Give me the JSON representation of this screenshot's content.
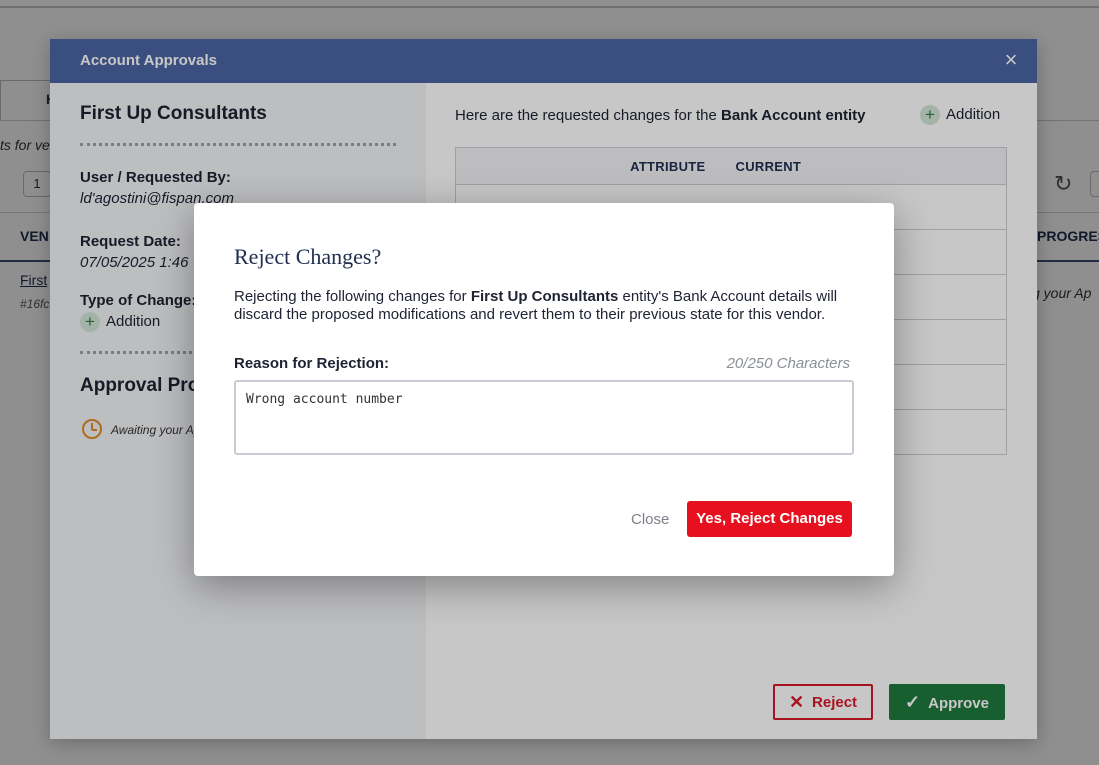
{
  "background": {
    "tab_label": "H",
    "subtitle": "ts for ve",
    "pager_value": "1",
    "col_vendor": "VEN",
    "col_progress": "PROGRES",
    "row_vendor": "First",
    "row_id": "#16fc",
    "row_status": "g your Ap"
  },
  "approvals": {
    "title": "Account Approvals",
    "close_icon": "×",
    "left": {
      "vendor_name": "First Up Consultants",
      "user_label": "User / Requested By:",
      "user_value": "ld'agostini@fispan.com",
      "date_label": "Request Date:",
      "date_value": "07/05/2025 1:46",
      "type_label": "Type of Change:",
      "type_value": "Addition",
      "progress_title": "Approval Prog",
      "awaiting": "Awaiting your Ap"
    },
    "right": {
      "intro_prefix": "Here are the requested changes for the ",
      "intro_entity": "Bank Account entity",
      "change_type": "Addition",
      "col_attribute": "ATTRIBUTE",
      "col_current": "CURRENT",
      "rows": [
        {
          "attribute": "",
          "current": ""
        },
        {
          "attribute": "",
          "current": ""
        },
        {
          "attribute": "",
          "current": ""
        },
        {
          "attribute": "",
          "current": ""
        },
        {
          "attribute": "",
          "current": ""
        },
        {
          "attribute": "",
          "current": ""
        }
      ]
    },
    "reject_label": "Reject",
    "approve_label": "Approve"
  },
  "reject_dialog": {
    "title": "Reject Changes?",
    "desc_prefix": "Rejecting the following changes for ",
    "desc_vendor": "First Up Consultants",
    "desc_suffix": " entity's Bank Account details will discard the proposed modifications and revert them to their previous state for this vendor.",
    "reason_label": "Reason for Rejection:",
    "char_count": "20/250 Characters",
    "reason_value": "Wrong account number",
    "close_label": "Close",
    "confirm_label": "Yes, Reject Changes"
  }
}
